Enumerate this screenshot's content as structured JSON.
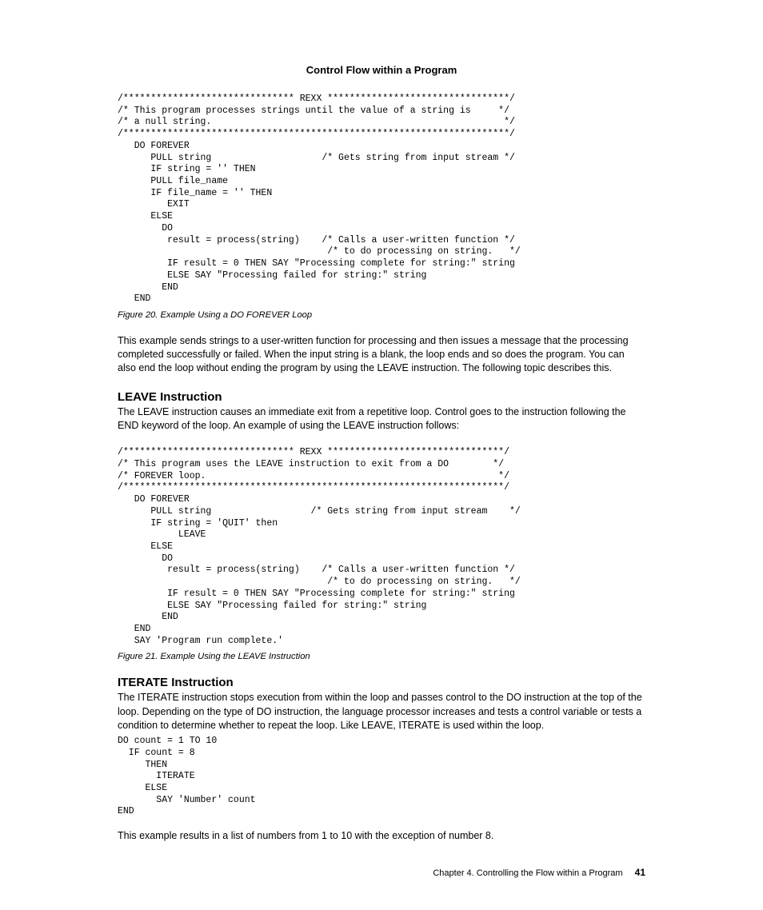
{
  "running_header": "Control Flow within a Program",
  "code_block_1": "/******************************* REXX *********************************/\n/* This program processes strings until the value of a string is     */\n/* a null string.                                                     */\n/**********************************************************************/\n   DO FOREVER\n      PULL string                    /* Gets string from input stream */\n      IF string = '' THEN\n      PULL file_name\n      IF file_name = '' THEN\n         EXIT\n      ELSE\n        DO\n         result = process(string)    /* Calls a user-written function */\n                                      /* to do processing on string.   */\n         IF result = 0 THEN SAY \"Processing complete for string:\" string\n         ELSE SAY \"Processing failed for string:\" string\n        END\n   END",
  "figure_caption_1": "Figure 20. Example Using a DO FOREVER Loop",
  "body_text_1": "This example sends strings to a user-written function for processing and then issues a message that the processing completed successfully or failed. When the input string is a blank, the loop ends and so does the program. You can also end the loop without ending the program by using the LEAVE instruction. The following topic describes this.",
  "section_leave_heading": "LEAVE Instruction",
  "section_leave_text": "The LEAVE instruction causes an immediate exit from a repetitive loop. Control goes to the instruction following the END keyword of the loop. An example of using the LEAVE instruction follows:",
  "code_block_2": "/******************************* REXX ********************************/\n/* This program uses the LEAVE instruction to exit from a DO        */\n/* FOREVER loop.                                                     */\n/*********************************************************************/\n   DO FOREVER\n      PULL string                  /* Gets string from input stream    */\n      IF string = 'QUIT' then\n           LEAVE\n      ELSE\n        DO\n         result = process(string)    /* Calls a user-written function */\n                                      /* to do processing on string.   */\n         IF result = 0 THEN SAY \"Processing complete for string:\" string\n         ELSE SAY \"Processing failed for string:\" string\n        END\n   END\n   SAY 'Program run complete.'",
  "figure_caption_2": "Figure 21. Example Using the LEAVE Instruction",
  "section_iterate_heading": "ITERATE Instruction",
  "section_iterate_text": "The ITERATE instruction stops execution from within the loop and passes control to the DO instruction at the top of the loop. Depending on the type of DO instruction, the language processor increases and tests a control variable or tests a condition to determine whether to repeat the loop. Like LEAVE, ITERATE is used within the loop.",
  "code_block_3": "DO count = 1 TO 10\n  IF count = 8\n     THEN\n       ITERATE\n     ELSE\n       SAY 'Number' count\nEND",
  "body_text_2": "This example results in a list of numbers from 1 to 10 with the exception of number 8.",
  "footer_chapter": "Chapter 4. Controlling the Flow within a Program",
  "footer_page": "41"
}
